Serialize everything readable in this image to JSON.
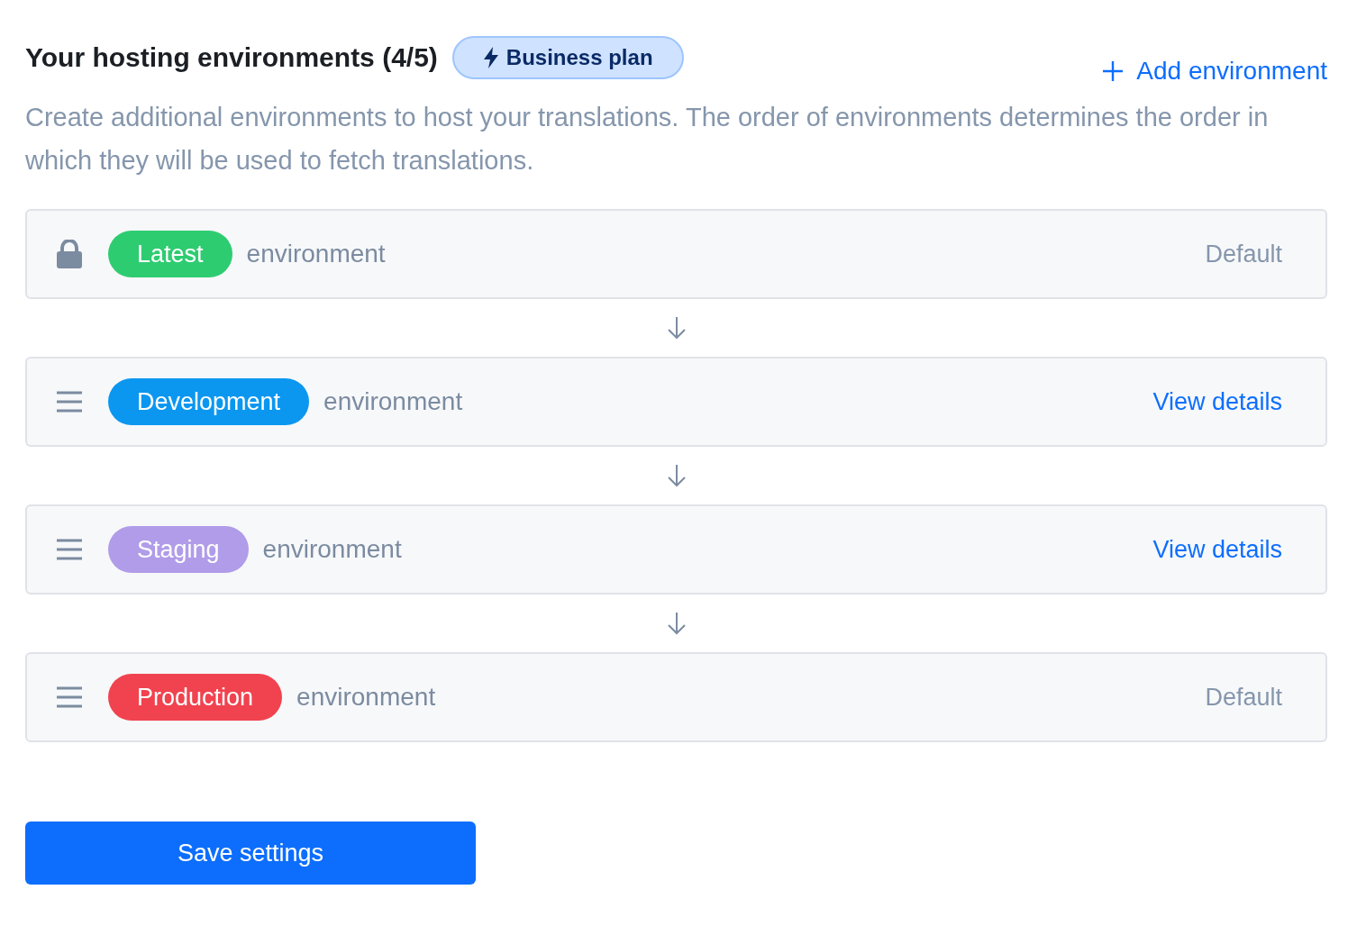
{
  "header": {
    "title": "Your hosting environments (4/5)",
    "plan_badge": "Business plan",
    "add_link": "Add environment"
  },
  "description": "Create additional environments to host your translations. The order of environments determines the order in which they will be used to fetch translations.",
  "environments": [
    {
      "kind": "locked",
      "name": "Latest",
      "color": "#2ecc71",
      "suffix": "environment",
      "action": {
        "kind": "text",
        "label": "Default"
      }
    },
    {
      "kind": "draggable",
      "name": "Development",
      "color": "#0b97f0",
      "suffix": "environment",
      "action": {
        "kind": "link",
        "label": "View details"
      }
    },
    {
      "kind": "draggable",
      "name": "Staging",
      "color": "#b09ce8",
      "suffix": "environment",
      "action": {
        "kind": "link",
        "label": "View details"
      }
    },
    {
      "kind": "draggable",
      "name": "Production",
      "color": "#f0434f",
      "suffix": "environment",
      "action": {
        "kind": "text",
        "label": "Default"
      }
    }
  ],
  "save_button": "Save settings"
}
